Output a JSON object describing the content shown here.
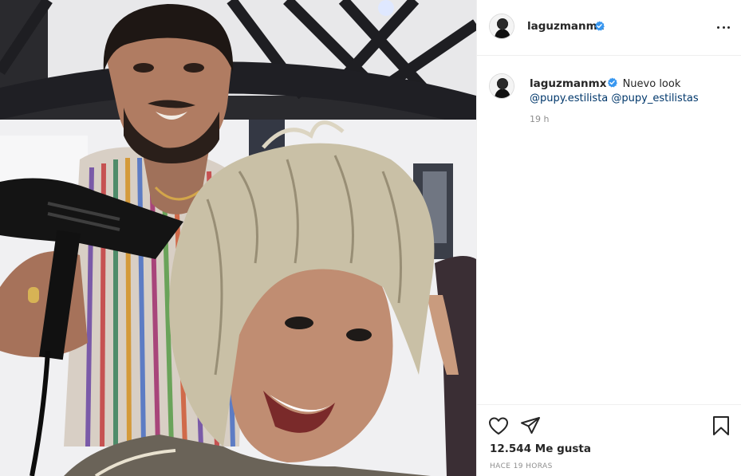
{
  "post": {
    "image_alt": "Selfie de una mujer rubia sonriendo mientras un estilista le seca el cabello",
    "account": {
      "username": "laguzmanmx",
      "verified": true
    },
    "caption": {
      "username": "laguzmanmx",
      "text": "Nuevo look",
      "mentions": [
        "@pupy.estilista",
        "@pupy_estilistas"
      ],
      "time_ago": "19 h"
    },
    "likes": "12.544 Me gusta",
    "posted_ago": "HACE 19 HORAS"
  },
  "icons": {
    "more": "more-options-icon",
    "like": "heart-icon",
    "share": "paper-plane-icon",
    "save": "bookmark-icon",
    "verified": "verified-badge-icon"
  },
  "colors": {
    "verified_blue": "#3897f0",
    "mention_blue": "#00376b",
    "muted_text": "#8e8e8e",
    "border": "#efefef"
  }
}
